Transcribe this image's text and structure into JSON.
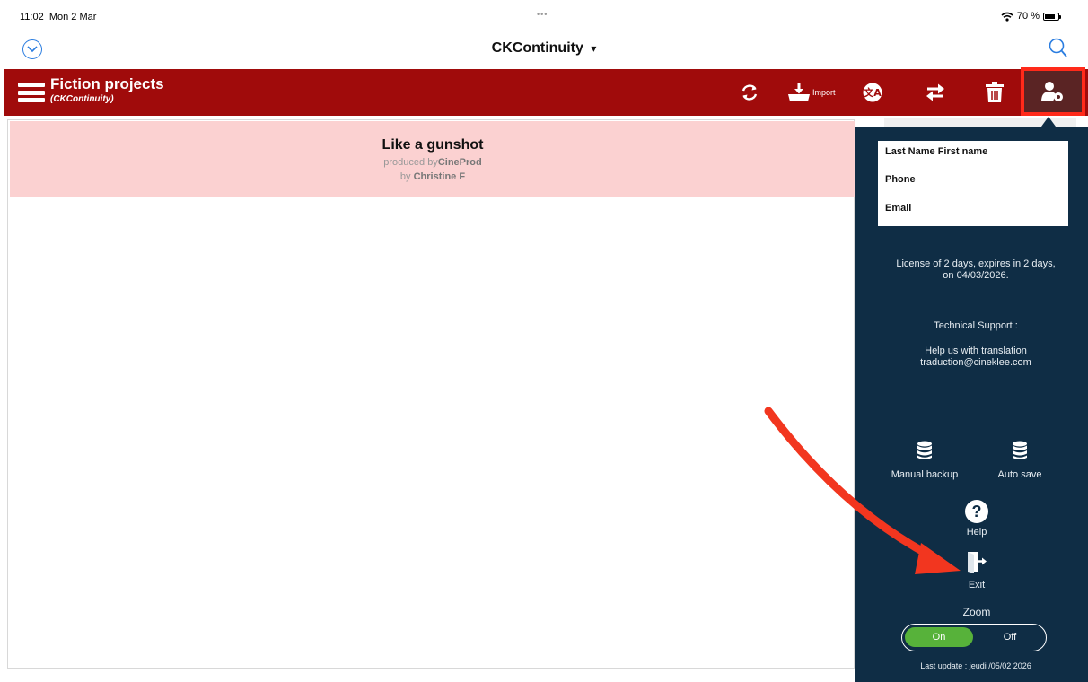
{
  "status_bar": {
    "time": "11:02",
    "date": "Mon 2 Mar",
    "dots": "•••",
    "battery": "70 %"
  },
  "nav": {
    "title": "CKContinuity",
    "title_caret": "▾"
  },
  "toolbar": {
    "title": "Fiction projects",
    "subtitle": "(CKContinuity)",
    "import_label": "Import",
    "accent_color": "#a00b0b",
    "highlight_color": "#ff2a1a"
  },
  "project": {
    "title": "Like a gunshot",
    "produced_prefix": "produced by",
    "producer": "CineProd",
    "by_prefix": "by ",
    "author": "Christine F"
  },
  "panel": {
    "user": {
      "name": "Last Name First name",
      "phone": "Phone",
      "email": "Email"
    },
    "license_line1": "License of 2 days, expires in 2 days,",
    "license_line2": "on 04/03/2026.",
    "support_title": "Technical Support :",
    "translation_line1": "Help us with translation",
    "translation_line2": "traduction@cineklee.com",
    "manual_backup": "Manual backup",
    "auto_save": "Auto save",
    "help": "Help",
    "exit": "Exit",
    "zoom": "Zoom",
    "zoom_on": "On",
    "zoom_off": "Off",
    "zoom_state": "On",
    "last_update": "Last update : jeudi /05/02 2026",
    "background_color": "#0f2d45",
    "toggle_on_color": "#57b23a"
  },
  "icons": {
    "nav_left": "chevron-down-circle-icon",
    "nav_right": "search-icon",
    "menu": "hamburger-menu-icon",
    "sync": "sync-icon",
    "import": "import-tray-icon",
    "language": "language-icon",
    "transfer": "transfer-arrows-icon",
    "delete": "trash-icon",
    "settings": "user-settings-icon",
    "backup": "database-icon",
    "help": "question-circle-icon",
    "exit": "exit-door-icon"
  }
}
